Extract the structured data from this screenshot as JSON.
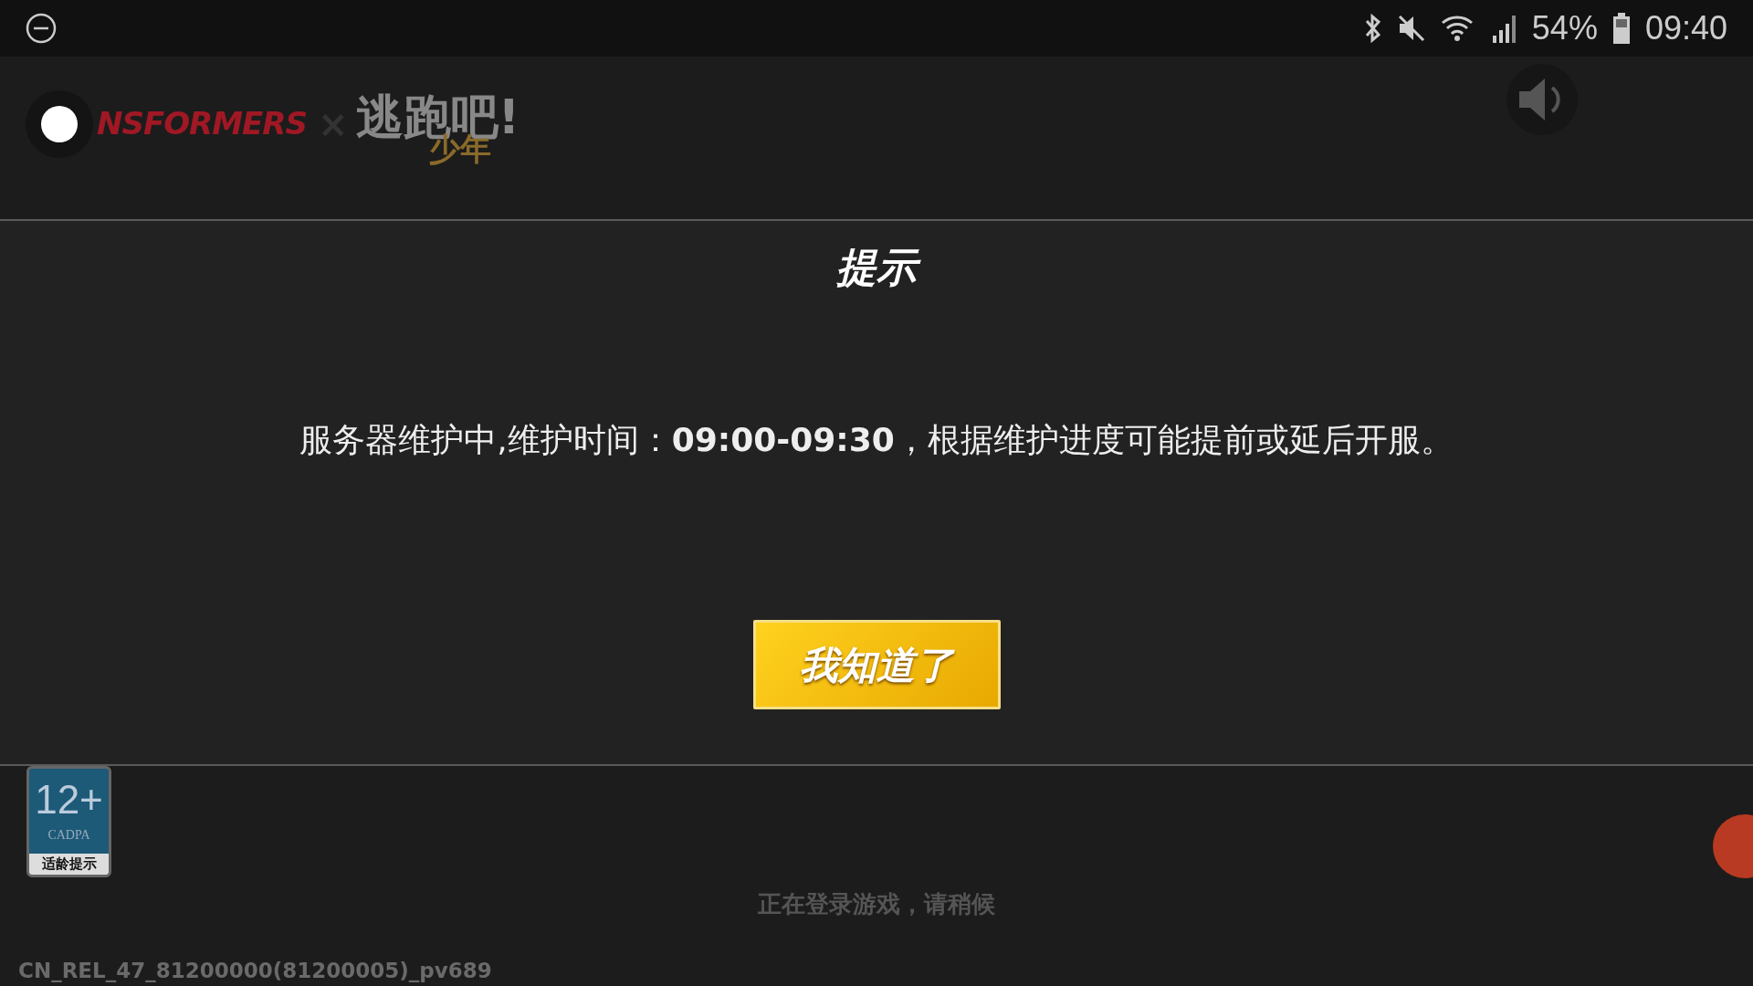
{
  "status_bar": {
    "battery": "54%",
    "time": "09:40"
  },
  "header": {
    "logo": {
      "left": "NSFORMERS",
      "cross": "×",
      "title": "逃跑吧!",
      "subtitle": "少年"
    }
  },
  "dialog": {
    "title": "提示",
    "message": "服务器维护中,维护时间：**09:00-09:30**，根据维护进度可能提前或延后开服。",
    "button": "我知道了"
  },
  "age_badge": {
    "rating": "12+",
    "org": "CADPA",
    "caption": "适龄提示"
  },
  "loading_text": "正在登录游戏，请稍候",
  "version": "CN_REL_47_81200000(81200005)_pv689"
}
